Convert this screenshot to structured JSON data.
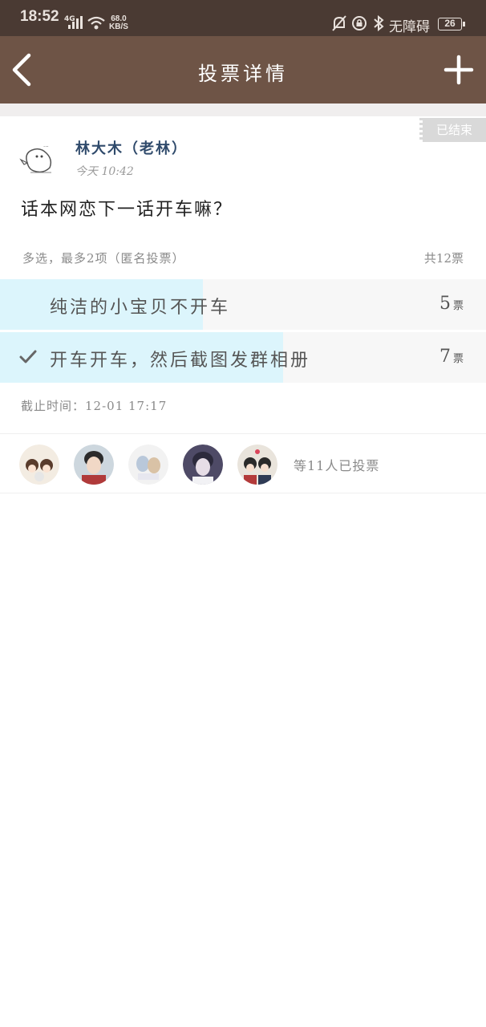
{
  "status_bar": {
    "time": "18:52",
    "network": "4G",
    "speed_value": "68.0",
    "speed_unit": "KB/S",
    "accessibility": "无障碍",
    "battery": "26"
  },
  "nav": {
    "title": "投票详情",
    "back_icon": "chevron-left-icon",
    "add_icon": "plus-icon"
  },
  "post": {
    "status_badge": "已结束",
    "author_name": "林大木（老林）",
    "post_time": "今天 10:42",
    "question": "话本网恋下一话开车嘛？"
  },
  "vote": {
    "mode": "多选，最多2项（匿名投票）",
    "total": "共12票",
    "unit": "票",
    "options": [
      {
        "label": "纯洁的小宝贝不开车",
        "count": "5",
        "share": 0.4167,
        "selected": false
      },
      {
        "label": "开车开车，然后截图发群相册",
        "count": "7",
        "share": 0.5833,
        "selected": true
      }
    ],
    "deadline": "截止时间：12-01 17:17"
  },
  "voters": {
    "summary": "等11人已投票"
  },
  "colors": {
    "status_bar_bg": "#4a3a33",
    "nav_bg": "#6e5446",
    "option_fill": "#dcf5fc",
    "author_name": "#2f4a6b"
  }
}
